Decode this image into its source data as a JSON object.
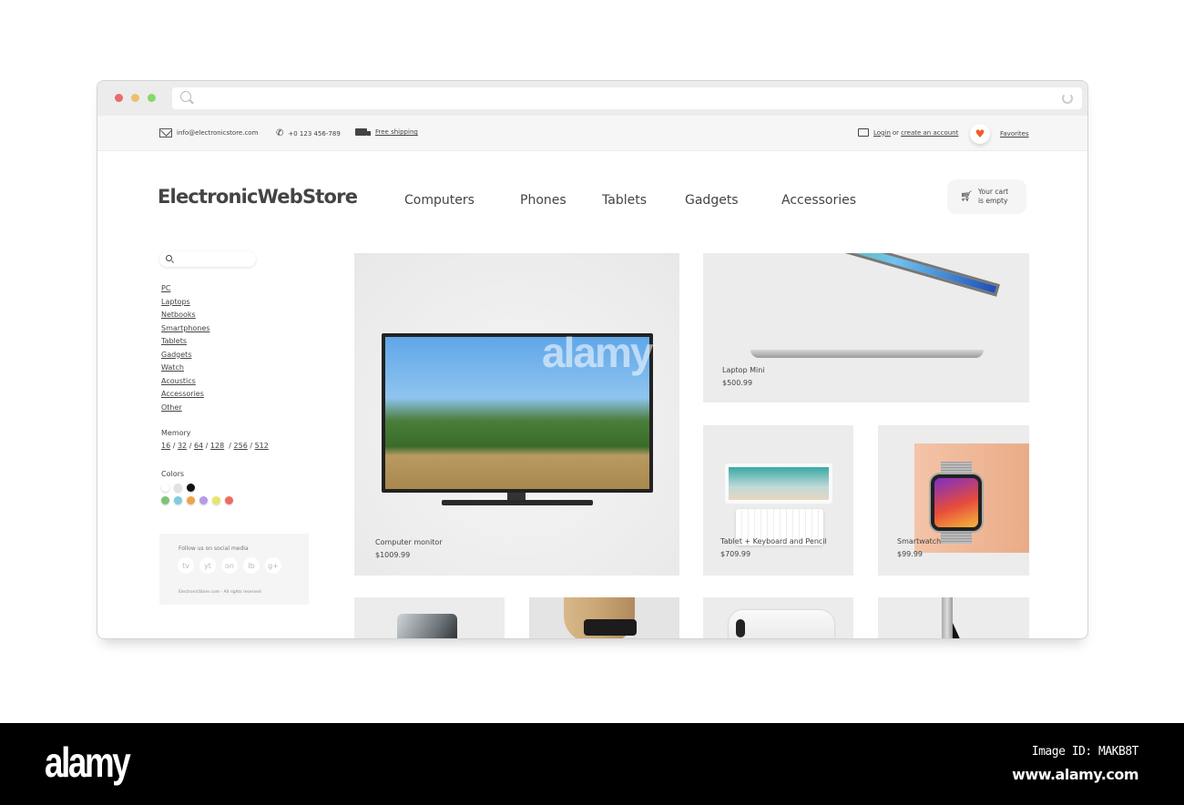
{
  "browser": {
    "traffic_lights": [
      "#ea6b6b",
      "#eec06b",
      "#86d868"
    ],
    "address_value": ""
  },
  "topbar": {
    "email": "info@electronicstore.com",
    "phone": "+0 123 456-789",
    "shipping": "Free shipping",
    "login": "Login",
    "login_or": "or",
    "create_account": "create an account",
    "favorites": "Favorites",
    "accent": "#f05a2c"
  },
  "header": {
    "logo": "ElectronicWebStore",
    "nav": [
      "Computers",
      "Phones",
      "Tablets",
      "Gadgets",
      "Accessories"
    ],
    "cart_line1": "Your cart",
    "cart_line2": "is empty"
  },
  "sidebar": {
    "search_placeholder": "",
    "categories": [
      "PC",
      "Laptops",
      "Netbooks",
      "Smartphones",
      "Tablets",
      "Gadgets",
      "Watch",
      "Acoustics",
      "Accessories",
      "Other"
    ],
    "memory_label": "Memory",
    "memory_values": [
      "16",
      "32",
      "64",
      "128",
      "256",
      "512"
    ],
    "colors_label": "Colors",
    "colors": [
      "#ffffff",
      "#e2e2e2",
      "#111111",
      "#7cc27a",
      "#7ccde0",
      "#f0a448",
      "#b59ae6",
      "#e8e46a",
      "#f06a5e"
    ],
    "social_title": "Follow us on social media",
    "social": [
      "tv",
      "yt",
      "on",
      "lb",
      "g+"
    ],
    "copyright": "ElectronicStore.com - All rights reserved"
  },
  "products": [
    {
      "name": "Computer monitor",
      "price": "$1009.99",
      "icon": "monitor-image"
    },
    {
      "name": "Laptop Mini",
      "price": "$500.99",
      "icon": "laptop-image"
    },
    {
      "name": "Tablet + Keyboard and Pencil",
      "price": "$709.99",
      "icon": "tablet-image"
    },
    {
      "name": "Smartwatch",
      "price": "$99.99",
      "icon": "smartwatch-image"
    }
  ],
  "partial_products": [
    "screen-protector-image",
    "vr-headset-image",
    "phone-case-image",
    "cable-image"
  ],
  "watermark": {
    "text": "alamy",
    "image_id": "Image ID: MAKB8T",
    "url": "www.alamy.com"
  }
}
